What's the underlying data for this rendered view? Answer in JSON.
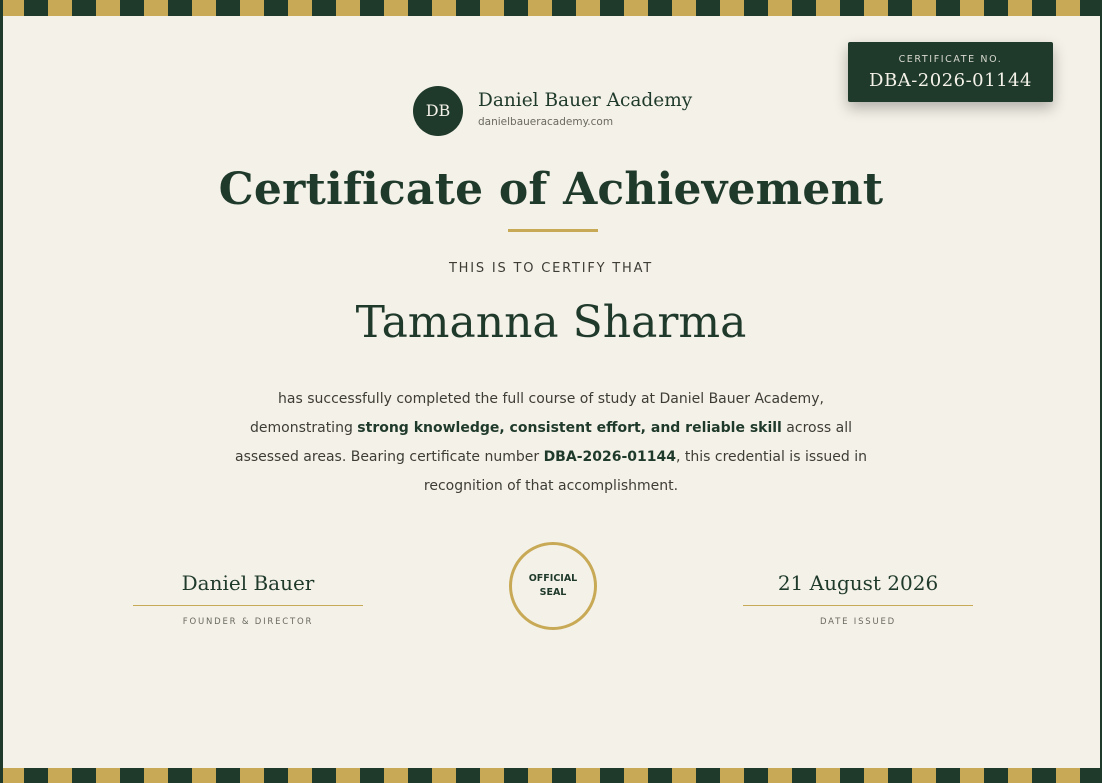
{
  "certificate_badge": {
    "label": "CERTIFICATE NO.",
    "number": "DBA-2026-01144"
  },
  "academy": {
    "initials": "DB",
    "name": "Daniel Bauer Academy",
    "url": "danielbaueracademy.com"
  },
  "title": "Certificate of Achievement",
  "certify_text": "THIS IS TO CERTIFY THAT",
  "recipient": "Tamanna Sharma",
  "body": {
    "part1": "has successfully completed the full course of study at Daniel Bauer Academy, demonstrating ",
    "emphasis1": "strong knowledge, consistent effort, and reliable skill",
    "part2": " across all assessed areas. Bearing certificate number ",
    "emphasis2": "DBA-2026-01144",
    "part3": ", this credential is issued in recognition of that accomplishment."
  },
  "signature": {
    "name": "Daniel Bauer",
    "role": "FOUNDER & DIRECTOR"
  },
  "seal": {
    "line1": "OFFICIAL",
    "line2": "SEAL"
  },
  "date": {
    "value": "21 August 2026",
    "label": "DATE ISSUED"
  },
  "colors": {
    "primary": "#1f3a2b",
    "gold": "#c8a955",
    "background": "#f4f1e8"
  }
}
